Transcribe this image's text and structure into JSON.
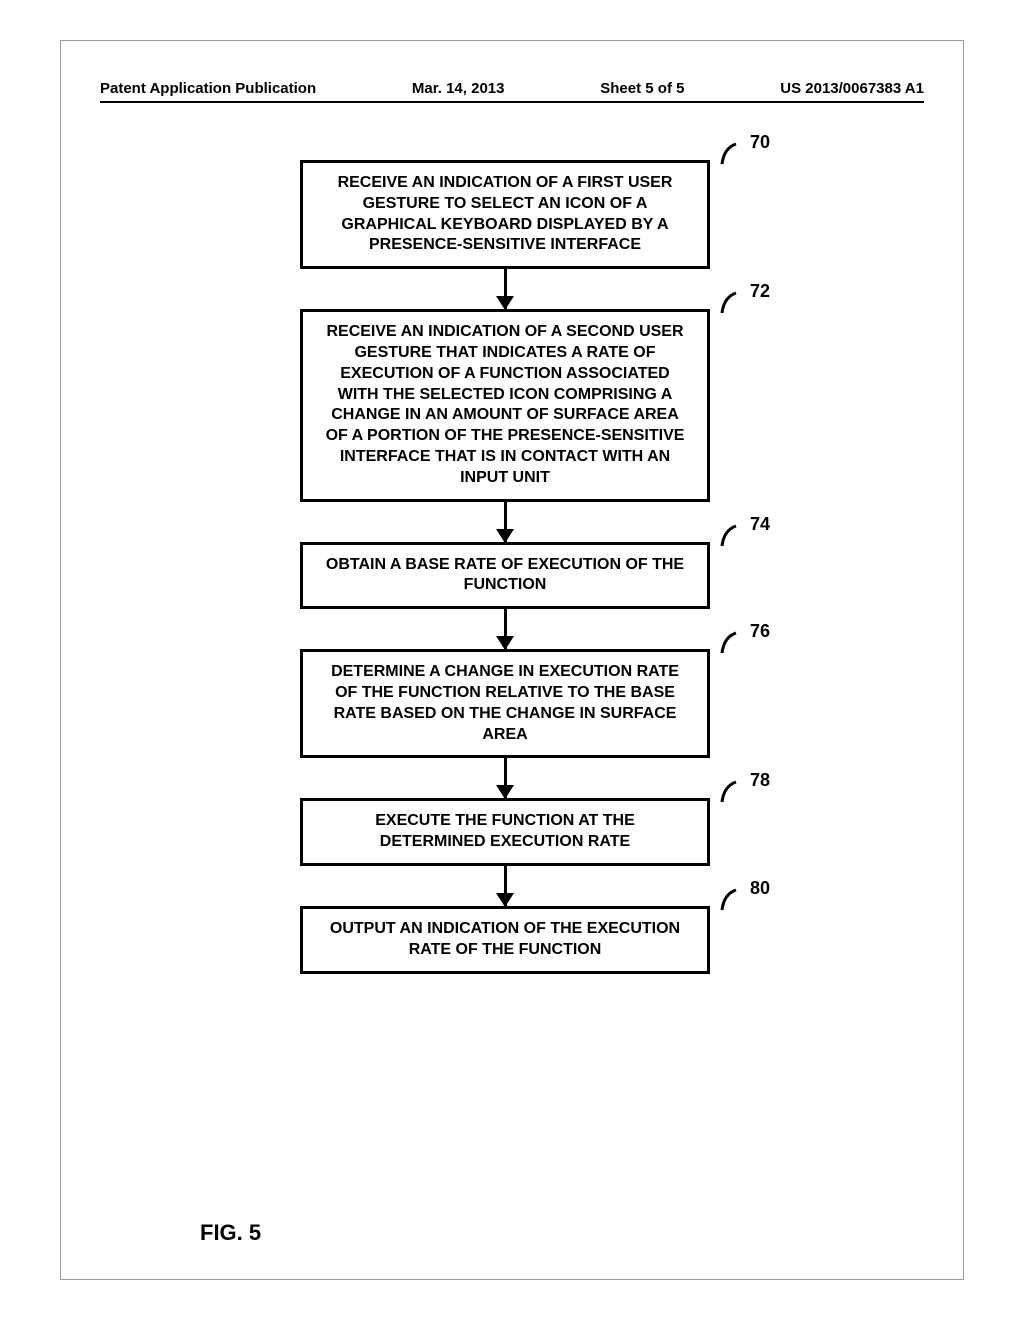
{
  "header": {
    "publication": "Patent Application Publication",
    "date": "Mar. 14, 2013",
    "sheet": "Sheet 5 of 5",
    "docnum": "US 2013/0067383 A1"
  },
  "figureLabel": "FIG. 5",
  "steps": [
    {
      "ref": "70",
      "text": "RECEIVE AN INDICATION OF A FIRST USER GESTURE TO SELECT AN ICON OF A GRAPHICAL KEYBOARD DISPLAYED BY A PRESENCE-SENSITIVE INTERFACE"
    },
    {
      "ref": "72",
      "text": "RECEIVE AN INDICATION OF A SECOND USER GESTURE THAT INDICATES A RATE OF EXECUTION OF A FUNCTION ASSOCIATED WITH THE SELECTED ICON COMPRISING A CHANGE IN AN AMOUNT OF SURFACE AREA OF A PORTION OF THE PRESENCE-SENSITIVE INTERFACE THAT IS IN CONTACT WITH AN INPUT UNIT"
    },
    {
      "ref": "74",
      "text": "OBTAIN A BASE RATE OF EXECUTION OF THE FUNCTION"
    },
    {
      "ref": "76",
      "text": "DETERMINE A CHANGE IN EXECUTION RATE OF THE FUNCTION RELATIVE TO THE BASE RATE BASED ON THE CHANGE IN SURFACE AREA"
    },
    {
      "ref": "78",
      "text": "EXECUTE THE FUNCTION AT THE DETERMINED EXECUTION RATE"
    },
    {
      "ref": "80",
      "text": "OUTPUT AN INDICATION OF THE EXECUTION RATE OF THE FUNCTION"
    }
  ]
}
